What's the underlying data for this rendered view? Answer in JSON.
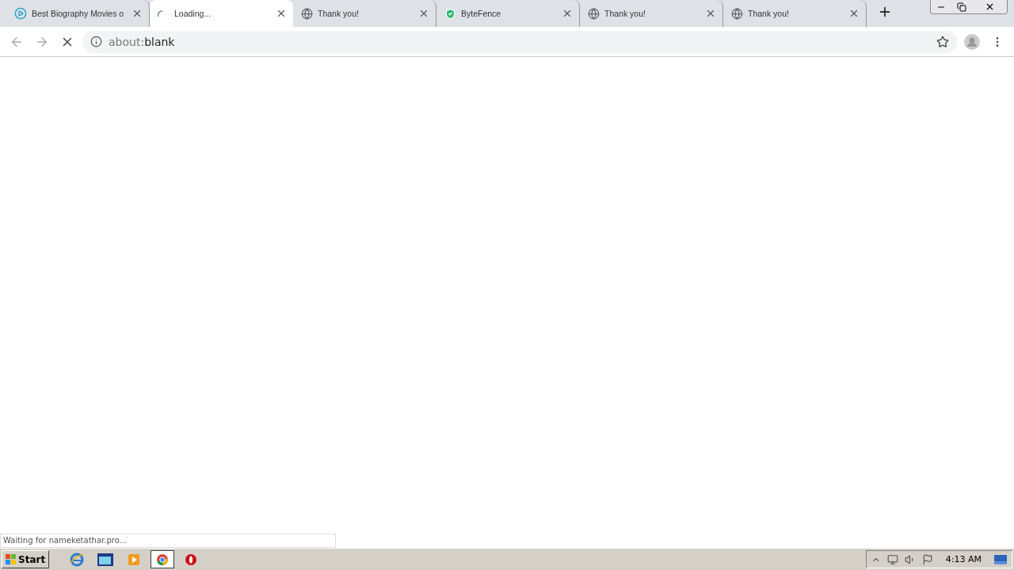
{
  "tabs": [
    {
      "kind": "play",
      "title": "Best Biography Movies o",
      "selected": false
    },
    {
      "kind": "spinner",
      "title": "Loading...",
      "selected": true
    },
    {
      "kind": "globe",
      "title": "Thank you!",
      "selected": false
    },
    {
      "kind": "shield",
      "title": "ByteFence",
      "selected": false
    },
    {
      "kind": "globe",
      "title": "Thank you!",
      "selected": false
    },
    {
      "kind": "globe",
      "title": "Thank you!",
      "selected": false
    }
  ],
  "toolbar": {
    "loading": true,
    "address": {
      "scheme": "about:",
      "path": "blank"
    }
  },
  "status_bubble": "Waiting for nameketathar.pro...",
  "taskbar": {
    "start": "Start",
    "items": [
      {
        "kind": "ie",
        "selected": false
      },
      {
        "kind": "folder",
        "selected": false
      },
      {
        "kind": "media",
        "selected": false
      },
      {
        "kind": "chrome",
        "selected": true
      },
      {
        "kind": "opera",
        "selected": false
      }
    ],
    "clock": "4:13 AM"
  }
}
